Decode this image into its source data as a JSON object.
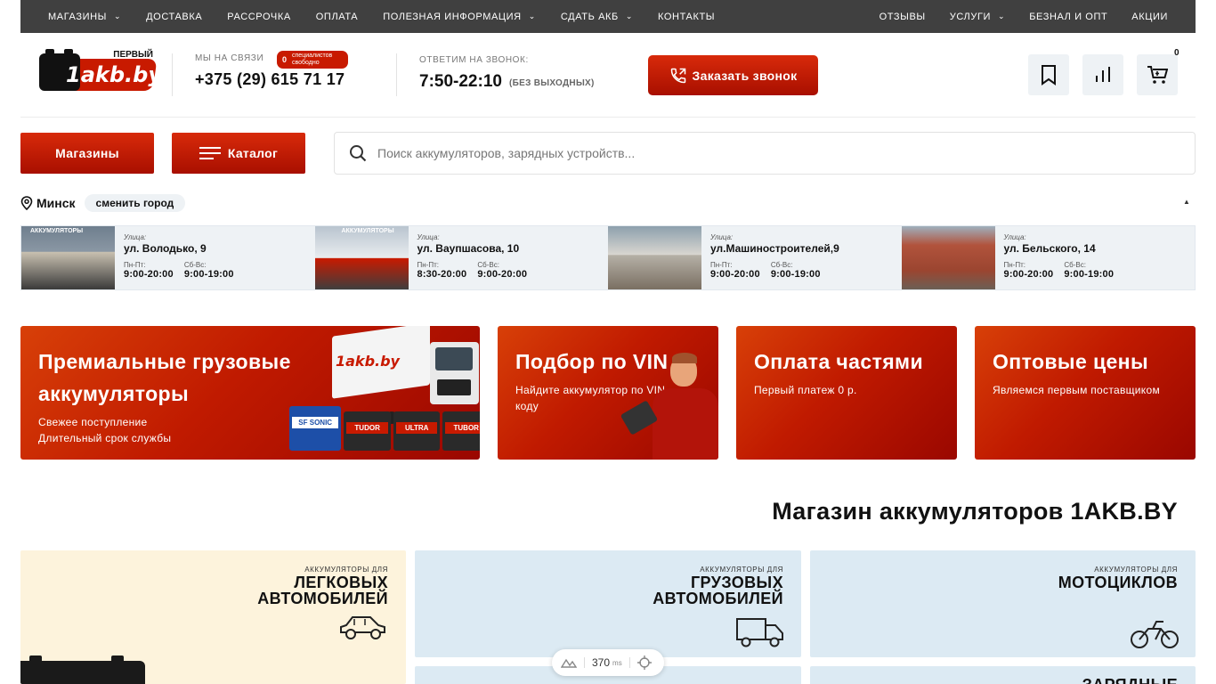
{
  "topnav": {
    "left": [
      {
        "label": "МАГАЗИНЫ",
        "dropdown": true
      },
      {
        "label": "ДОСТАВКА",
        "dropdown": false
      },
      {
        "label": "РАССРОЧКА",
        "dropdown": false
      },
      {
        "label": "ОПЛАТА",
        "dropdown": false
      },
      {
        "label": "ПОЛЕЗНАЯ ИНФОРМАЦИЯ",
        "dropdown": true
      },
      {
        "label": "СДАТЬ АКБ",
        "dropdown": true
      },
      {
        "label": "КОНТАКТЫ",
        "dropdown": false
      }
    ],
    "right": [
      {
        "label": "ОТЗЫВЫ",
        "dropdown": false
      },
      {
        "label": "УСЛУГИ",
        "dropdown": true
      },
      {
        "label": "БЕЗНАЛ И ОПТ",
        "dropdown": false
      },
      {
        "label": "АКЦИИ",
        "dropdown": false
      }
    ]
  },
  "header": {
    "logo_top": "ПЕРВЫЙ",
    "logo_text": "1akb.by",
    "contact_label": "МЫ НА СВЯЗИ",
    "badge_count": "0",
    "badge_text_1": "специалистов",
    "badge_text_2": "свободно",
    "phone": "+375 (29) 615 71 17",
    "hours_label": "ОТВЕТИМ НА ЗВОНОК:",
    "hours": "7:50-22:10",
    "hours_note": "(БЕЗ ВЫХОДНЫХ)",
    "callback_label": "Заказать звонок",
    "cart_count": "0"
  },
  "actions": {
    "stores_label": "Магазины",
    "catalog_label": "Каталог",
    "search_placeholder": "Поиск аккумуляторов, зарядных устройств..."
  },
  "city": {
    "name": "Минск",
    "change_label": "сменить город",
    "collapse_glyph": "▲"
  },
  "stores": [
    {
      "label": "Улица:",
      "address": "ул. Володько, 9",
      "wd_label": "Пн-Пт:",
      "wd": "9:00-20:00",
      "we_label": "Сб-Вс:",
      "we": "9:00-19:00"
    },
    {
      "label": "Улица:",
      "address": "ул. Ваупшасова, 10",
      "wd_label": "Пн-Пт:",
      "wd": "8:30-20:00",
      "we_label": "Сб-Вс:",
      "we": "9:00-20:00"
    },
    {
      "label": "Улица:",
      "address": "ул.Машиностроителей,9",
      "wd_label": "Пн-Пт:",
      "wd": "9:00-20:00",
      "we_label": "Сб-Вс:",
      "we": "9:00-19:00"
    },
    {
      "label": "Улица:",
      "address": "ул. Бельского, 14",
      "wd_label": "Пн-Пт:",
      "wd": "9:00-20:00",
      "we_label": "Сб-Вс:",
      "we": "9:00-19:00"
    }
  ],
  "store_photo_signs": [
    "АККУМУЛЯТОРЫ",
    "АККУМУЛЯТОРЫ"
  ],
  "promos": {
    "trucks": {
      "title_1": "Премиальные грузовые",
      "title_2": "аккумуляторы",
      "sub_1": "Свежее поступление",
      "sub_2": "Длительный срок службы",
      "truck_logo": "1akb.by",
      "batteries": [
        "SF SONIC",
        "TUDOR",
        "ULTRA",
        "TUBOR"
      ]
    },
    "vin": {
      "title": "Подбор по VIN",
      "sub_1": "Найдите аккумулятор по VIN-",
      "sub_2": "коду"
    },
    "parts": {
      "title": "Оплата частями",
      "sub": "Первый платеж 0 р."
    },
    "wholesale": {
      "title": "Оптовые цены",
      "sub": "Являемся первым поставщиком"
    }
  },
  "section_title": "Магазин аккумуляторов 1AKB.BY",
  "categories": {
    "cars": {
      "small": "АККУМУЛЯТОРЫ ДЛЯ",
      "big_1": "ЛЕГКОВЫХ",
      "big_2": "АВТОМОБИЛЕЙ"
    },
    "trucks": {
      "small": "АККУМУЛЯТОРЫ ДЛЯ",
      "big_1": "ГРУЗОВЫХ",
      "big_2": "АВТОМОБИЛЕЙ"
    },
    "moto": {
      "small": "АККУМУЛЯТОРЫ ДЛЯ",
      "big_1": "МОТОЦИКЛОВ"
    },
    "chargers": {
      "big_1": "ЗАРЯДНЫЕ"
    }
  },
  "perf": {
    "value": "370",
    "unit": "ms"
  },
  "colors": {
    "accent": "#c81a00",
    "nav_bg": "#404040",
    "light_bg": "#eef2f5",
    "cream": "#fdf3dc",
    "pale_blue": "#dceaf3"
  }
}
